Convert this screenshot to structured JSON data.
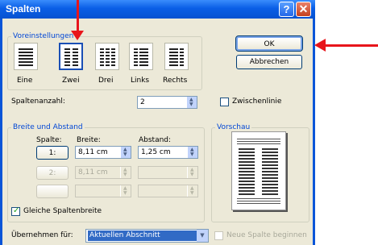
{
  "window": {
    "title": "Spalten",
    "help_glyph": "?",
    "close_glyph": "✕"
  },
  "presets": {
    "group_label": "Voreinstellungen",
    "items": [
      {
        "label": "Eine",
        "columns": 1,
        "selected": false
      },
      {
        "label": "Zwei",
        "columns": 2,
        "selected": true
      },
      {
        "label": "Drei",
        "columns": 3,
        "selected": false
      },
      {
        "label": "Links",
        "columns": 2,
        "selected": false
      },
      {
        "label": "Rechts",
        "columns": 2,
        "selected": false
      }
    ]
  },
  "buttons": {
    "ok": "OK",
    "cancel": "Abbrechen"
  },
  "column_count": {
    "label": "Spaltenanzahl:",
    "value": "2"
  },
  "separator": {
    "label": "Zwischenlinie",
    "checked": false
  },
  "width_spacing": {
    "group_label": "Breite und Abstand",
    "headers": {
      "column": "Spalte:",
      "width": "Breite:",
      "spacing": "Abstand:"
    },
    "rows": [
      {
        "col": "1:",
        "width": "8,11 cm",
        "spacing": "1,25 cm",
        "enabled": true
      },
      {
        "col": "2:",
        "width": "8,11 cm",
        "spacing": "",
        "enabled": false
      },
      {
        "col": "",
        "width": "",
        "spacing": "",
        "enabled": false
      }
    ],
    "equal_width": {
      "label": "Gleiche Spaltenbreite",
      "checked": true
    }
  },
  "preview": {
    "label": "Vorschau"
  },
  "apply_to": {
    "label": "Übernehmen für:",
    "value": "Aktuellen Abschnitt"
  },
  "new_column": {
    "label": "Neue Spalte beginnen",
    "checked": false,
    "enabled": false
  },
  "colors": {
    "title_blue": "#0a5ee6",
    "group_label": "#0046d5",
    "arrow": "#e8151b",
    "selection": "#316ac5"
  }
}
